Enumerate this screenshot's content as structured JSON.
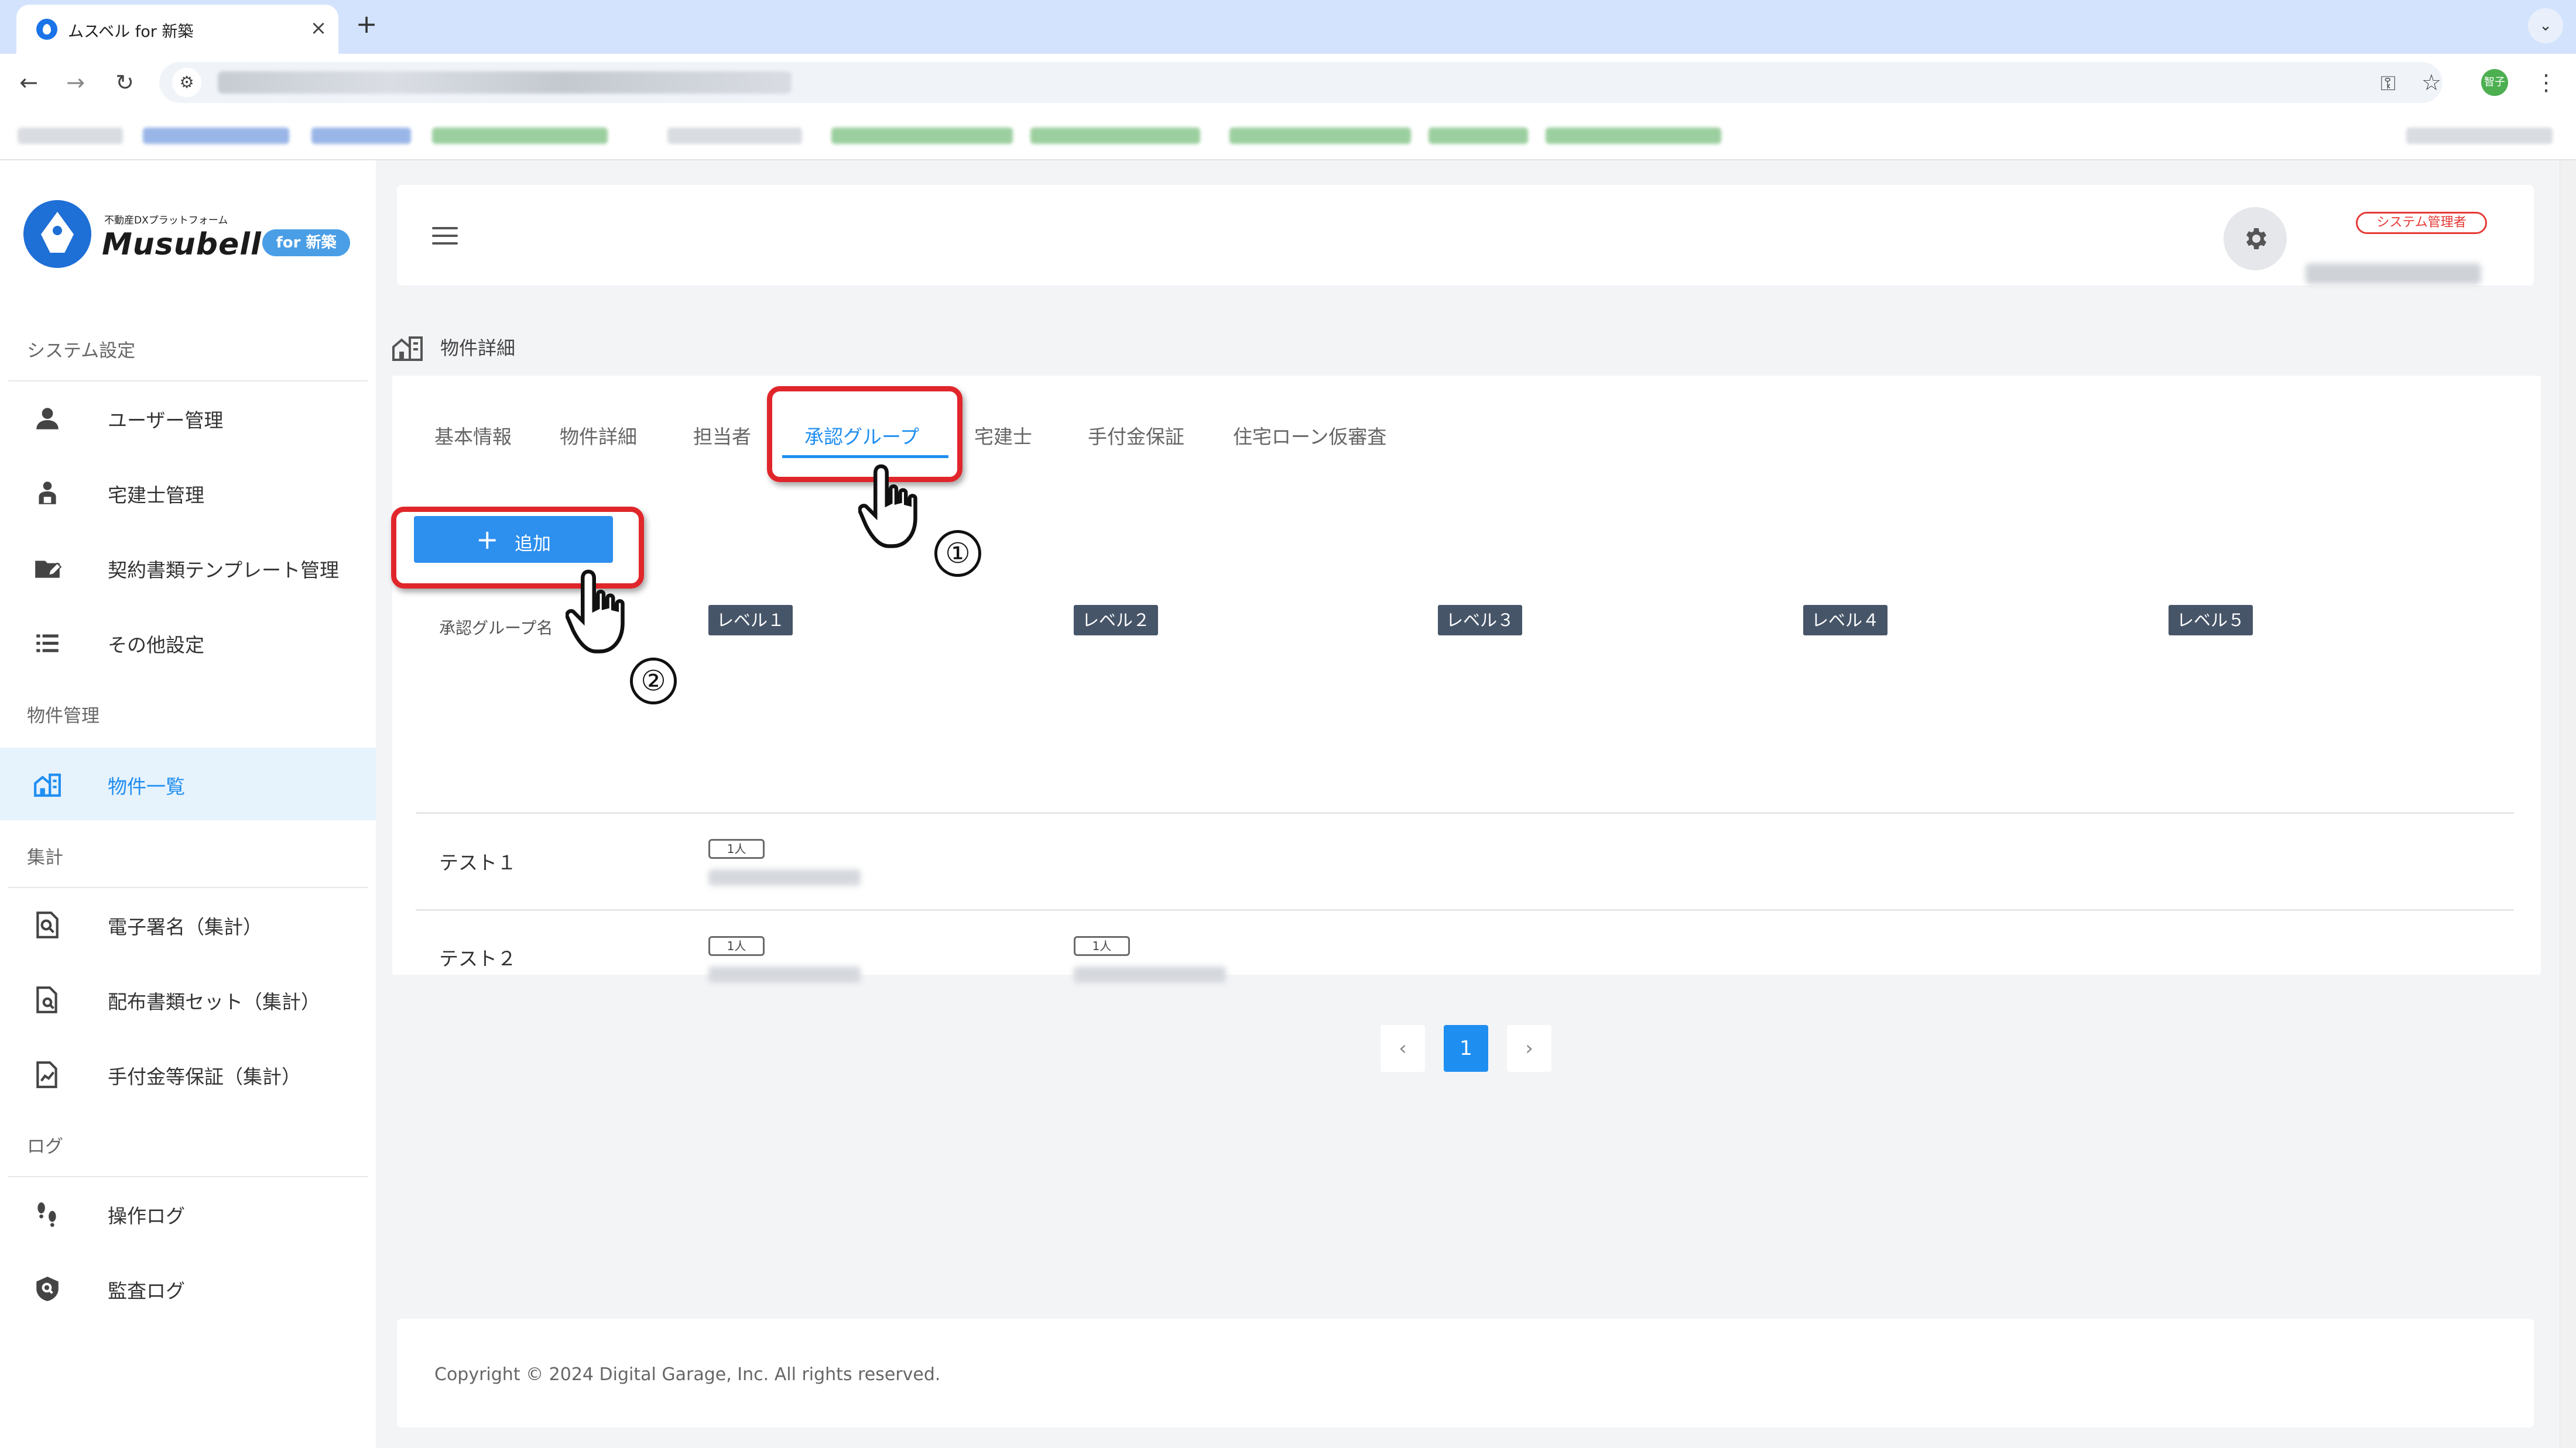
{
  "browser": {
    "tab_title": "ムスベル for 新築",
    "close_glyph": "×",
    "newtab_glyph": "+",
    "tablist_glyph": "⌄",
    "back_glyph": "←",
    "forward_glyph": "→",
    "reload_glyph": "↻",
    "tune_glyph": "⚙",
    "key_glyph": "⚿",
    "star_glyph": "☆",
    "menu_glyph": "⋮",
    "avatar_text": "智子"
  },
  "logo": {
    "tagline": "不動産DXプラットフォーム",
    "name": "Musubell",
    "badge": "for 新築"
  },
  "sidebar": {
    "sections": [
      {
        "title": "システム設定"
      },
      {
        "title": "物件管理"
      },
      {
        "title": "集計"
      },
      {
        "title": "ログ"
      }
    ],
    "items": [
      {
        "label": "ユーザー管理",
        "icon": "user-icon"
      },
      {
        "label": "宅建士管理",
        "icon": "agent-icon"
      },
      {
        "label": "契約書類テンプレート管理",
        "icon": "edit-folder-icon"
      },
      {
        "label": "その他設定",
        "icon": "list-icon"
      },
      {
        "label": "物件一覧",
        "icon": "building-icon",
        "active": true
      },
      {
        "label": "電子署名（集計）",
        "icon": "document-search-icon"
      },
      {
        "label": "配布書類セット（集計）",
        "icon": "file-search-icon"
      },
      {
        "label": "手付金等保証（集計）",
        "icon": "chart-file-icon"
      },
      {
        "label": "操作ログ",
        "icon": "footsteps-icon"
      },
      {
        "label": "監査ログ",
        "icon": "shield-search-icon"
      }
    ]
  },
  "header": {
    "role_badge": "システム管理者"
  },
  "page": {
    "title": "物件詳細"
  },
  "tabs": [
    {
      "label": "基本情報"
    },
    {
      "label": "物件詳細"
    },
    {
      "label": "担当者"
    },
    {
      "label": "承認グループ",
      "active": true
    },
    {
      "label": "宅建士"
    },
    {
      "label": "手付金保証"
    },
    {
      "label": "住宅ローン仮審査"
    }
  ],
  "actions": {
    "add_plus": "+",
    "add_label": "追加"
  },
  "table": {
    "name_header": "承認グループ名",
    "levels": [
      "レベル１",
      "レベル２",
      "レベル３",
      "レベル４",
      "レベル５"
    ],
    "rows": [
      {
        "name": "テスト１",
        "counts": [
          "1人"
        ]
      },
      {
        "name": "テスト２",
        "counts": [
          "1人",
          "1人"
        ]
      }
    ]
  },
  "pagination": {
    "prev": "‹",
    "current": "1",
    "next": "›"
  },
  "footer": {
    "copyright": "Copyright © 2024 Digital Garage, Inc. All rights reserved."
  },
  "annotations": {
    "step1": "①",
    "step2": "②",
    "highlight_color": "#e0262b"
  },
  "colors": {
    "accent": "#1f8ef1",
    "button": "#2d8fee",
    "level_badge": "#475569",
    "role_badge": "#e53935"
  }
}
